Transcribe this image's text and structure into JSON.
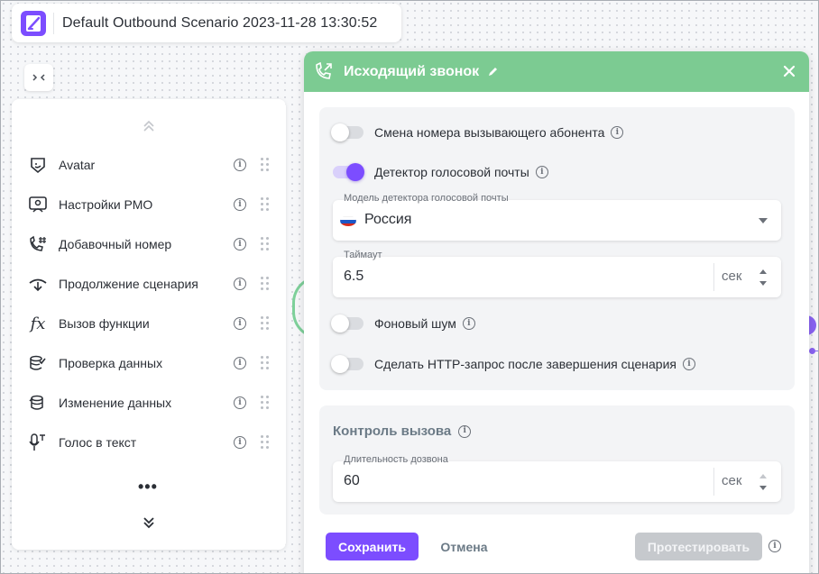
{
  "topbar": {
    "scenario_title": "Default Outbound Scenario 2023-11-28 13:30:52",
    "logo_icon": "app-logo-icon"
  },
  "collapse": {
    "label": ">‹",
    "icon": "collapse-panel-icon"
  },
  "palette": {
    "items": [
      {
        "label": "Avatar",
        "icon": "avatar-badge-icon"
      },
      {
        "label": "Настройки РМО",
        "icon": "operator-workplace-icon"
      },
      {
        "label": "Добавочный номер",
        "icon": "phone-extension-icon"
      },
      {
        "label": "Продолжение сценария",
        "icon": "scenario-continue-icon"
      },
      {
        "label": "Вызов функции",
        "icon": "function-icon"
      },
      {
        "label": "Проверка данных",
        "icon": "data-check-icon"
      },
      {
        "label": "Изменение данных",
        "icon": "data-edit-icon"
      },
      {
        "label": "Голос в текст",
        "icon": "speech-to-text-icon"
      }
    ],
    "more_label": "•••"
  },
  "dialog": {
    "title": "Исходящий звонок",
    "header_color": "#7ccb92",
    "toggles": {
      "caller_id_change": {
        "label": "Смена номера вызывающего абонента",
        "on": false
      },
      "voicemail_detector": {
        "label": "Детектор голосовой почты",
        "on": true
      },
      "background_noise": {
        "label": "Фоновый шум",
        "on": false
      },
      "http_after": {
        "label": "Сделать HTTP-запрос после завершения сценария",
        "on": false
      }
    },
    "detector_model": {
      "label": "Модель детектора голосовой почты",
      "value": "Россия"
    },
    "timeout": {
      "label": "Таймаут",
      "value": "6.5",
      "unit": "сек"
    },
    "call_control": {
      "title": "Контроль вызова",
      "dial_duration": {
        "label": "Длительность дозвона",
        "value": "60",
        "unit": "сек"
      }
    },
    "buttons": {
      "save": "Сохранить",
      "cancel": "Отмена",
      "test": "Протестировать"
    },
    "accent_color": "#7c4dff"
  }
}
